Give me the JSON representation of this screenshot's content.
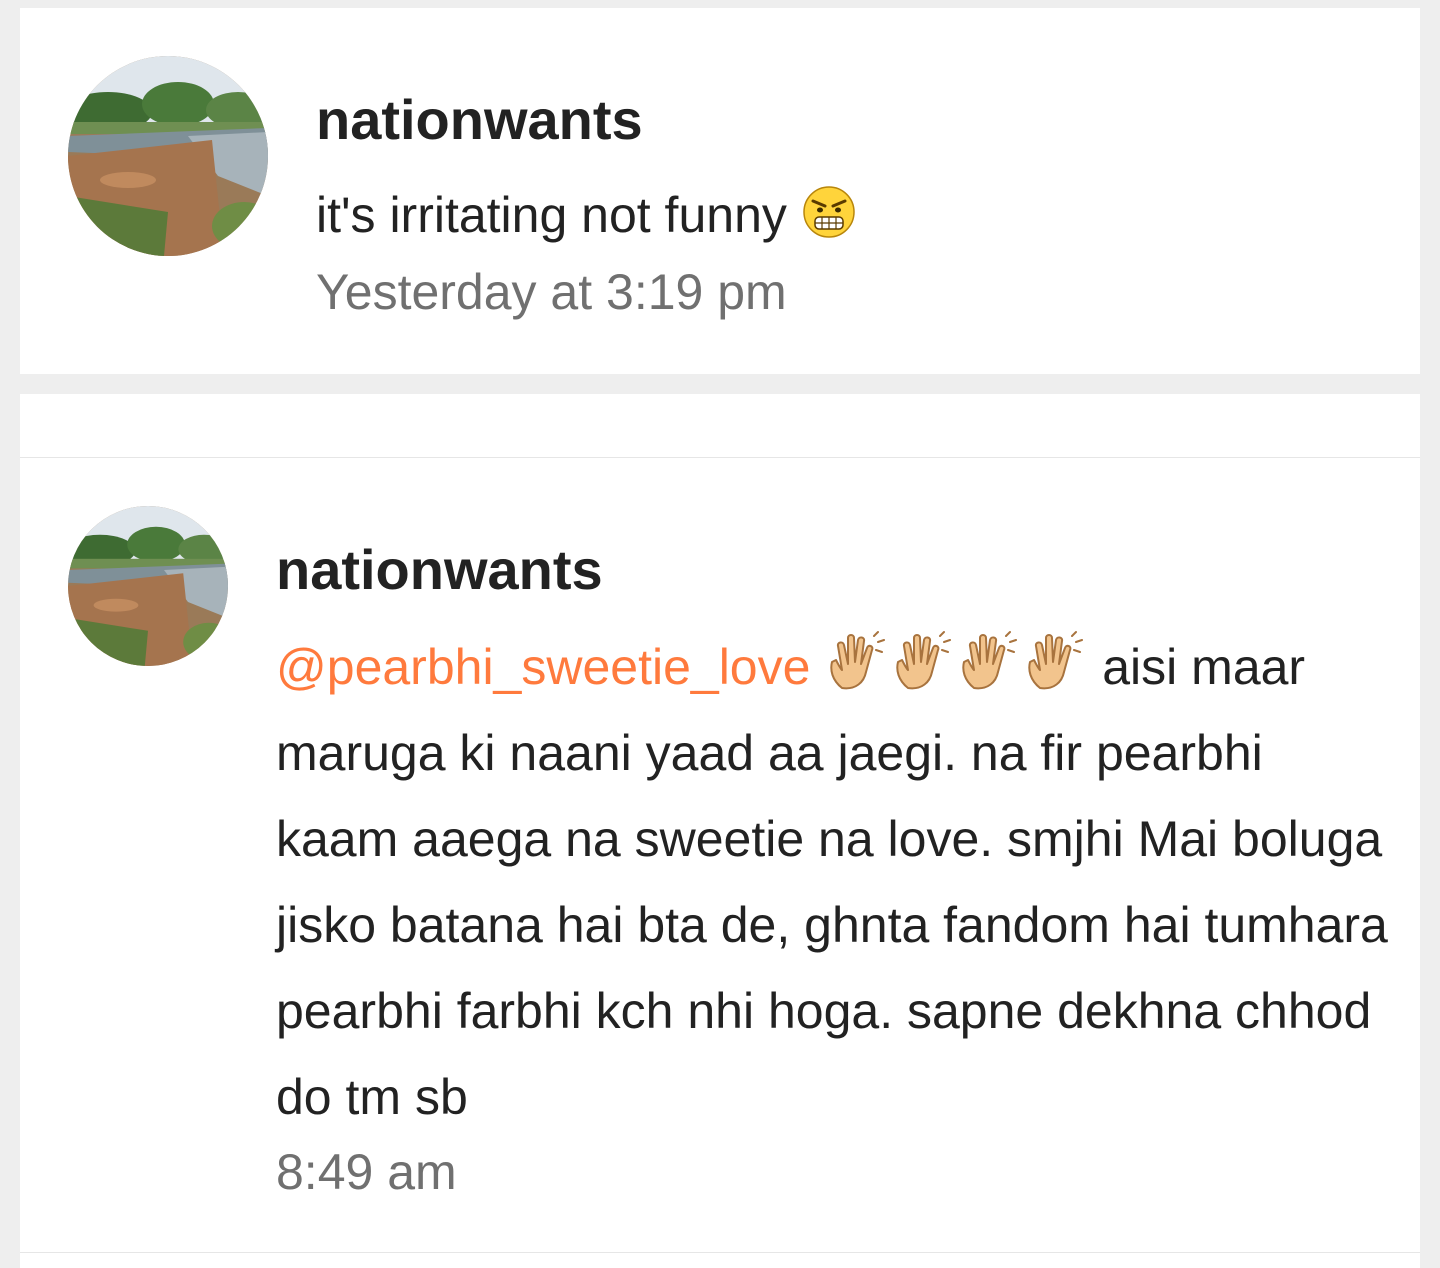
{
  "comments": [
    {
      "username": "nationwants",
      "text": "it's irritating not funny",
      "emoji": "grimacing-angry-face-icon",
      "timestamp": "Yesterday at 3:19 pm"
    },
    {
      "username": "nationwants",
      "mention": "@pearbhi_sweetie_love",
      "emoji": "waving-hand-icon",
      "text": "aisi maar maruga ki naani yaad aa jaegi. na fir pearbhi kaam aaega na sweetie na love. smjhi Mai boluga jisko batana hai bta de, ghnta fandom hai tumhara pearbhi farbhi kch nhi hoga. sapne dekhna chhod do tm sb",
      "timestamp": "8:49 am"
    }
  ],
  "colors": {
    "mention": "#ff7a3d",
    "background": "#eeeeee",
    "card": "#ffffff",
    "timestamp": "#707070"
  }
}
